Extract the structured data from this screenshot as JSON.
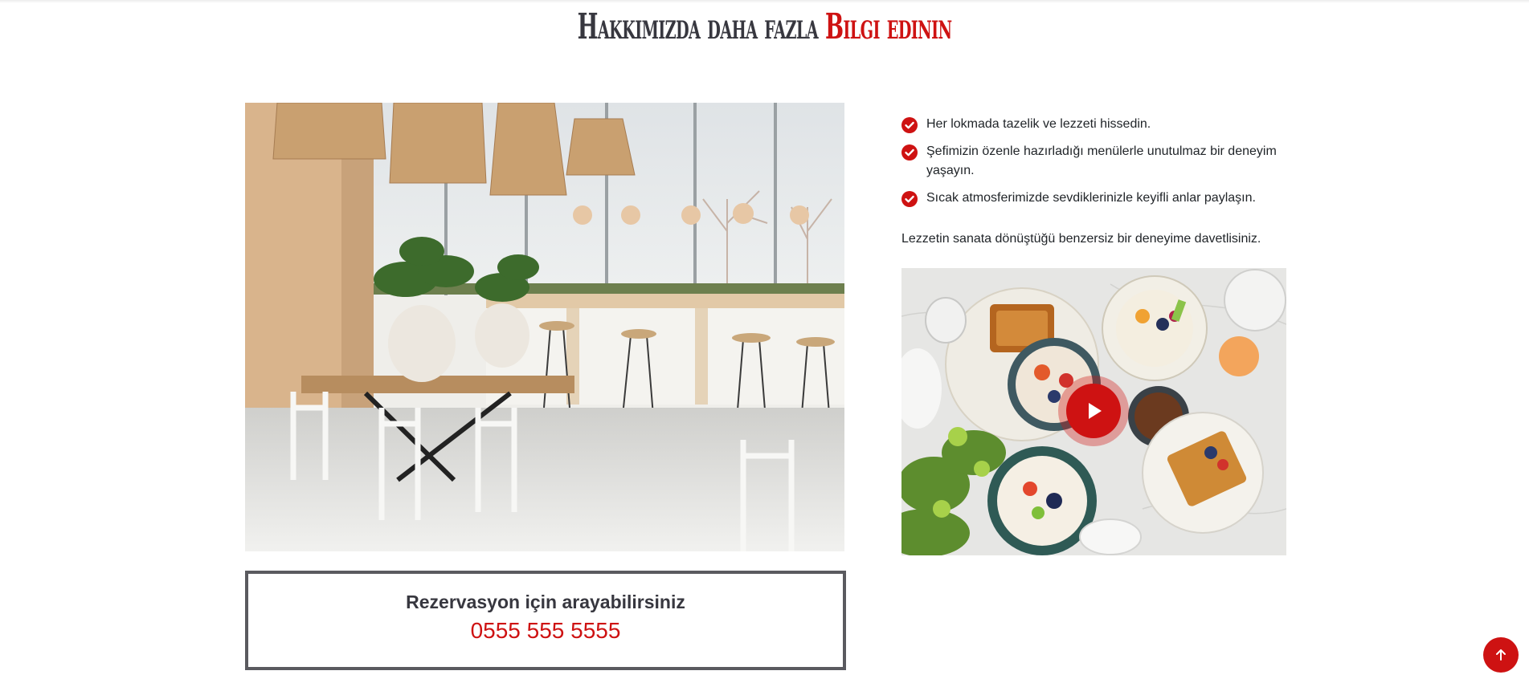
{
  "section": {
    "title_main": "Hakkımızda daha fazla",
    "title_accent": "Bilgi edinin"
  },
  "features": [
    {
      "text": "Her lokmada tazelik ve lezzeti hissedin."
    },
    {
      "text": "Şefimizin özenle hazırladığı menülerle unutulmaz bir deneyim yaşayın."
    },
    {
      "text": "Sıcak atmosferimizde sevdiklerinizle keyifli anlar paylaşın."
    }
  ],
  "tagline": "Lezzetin sanata dönüştüğü benzersiz bir deneyime davetlisiniz.",
  "call_box": {
    "label": "Rezervasyon için arayabilirsiniz",
    "phone": "0555 555 5555"
  },
  "icons": {
    "feature_check": "check-circle-icon",
    "video_play": "play-icon",
    "scroll_top": "arrow-up-icon"
  },
  "colors": {
    "accent": "#ce1212",
    "heading": "#37373f",
    "border": "#5a5a5f"
  }
}
